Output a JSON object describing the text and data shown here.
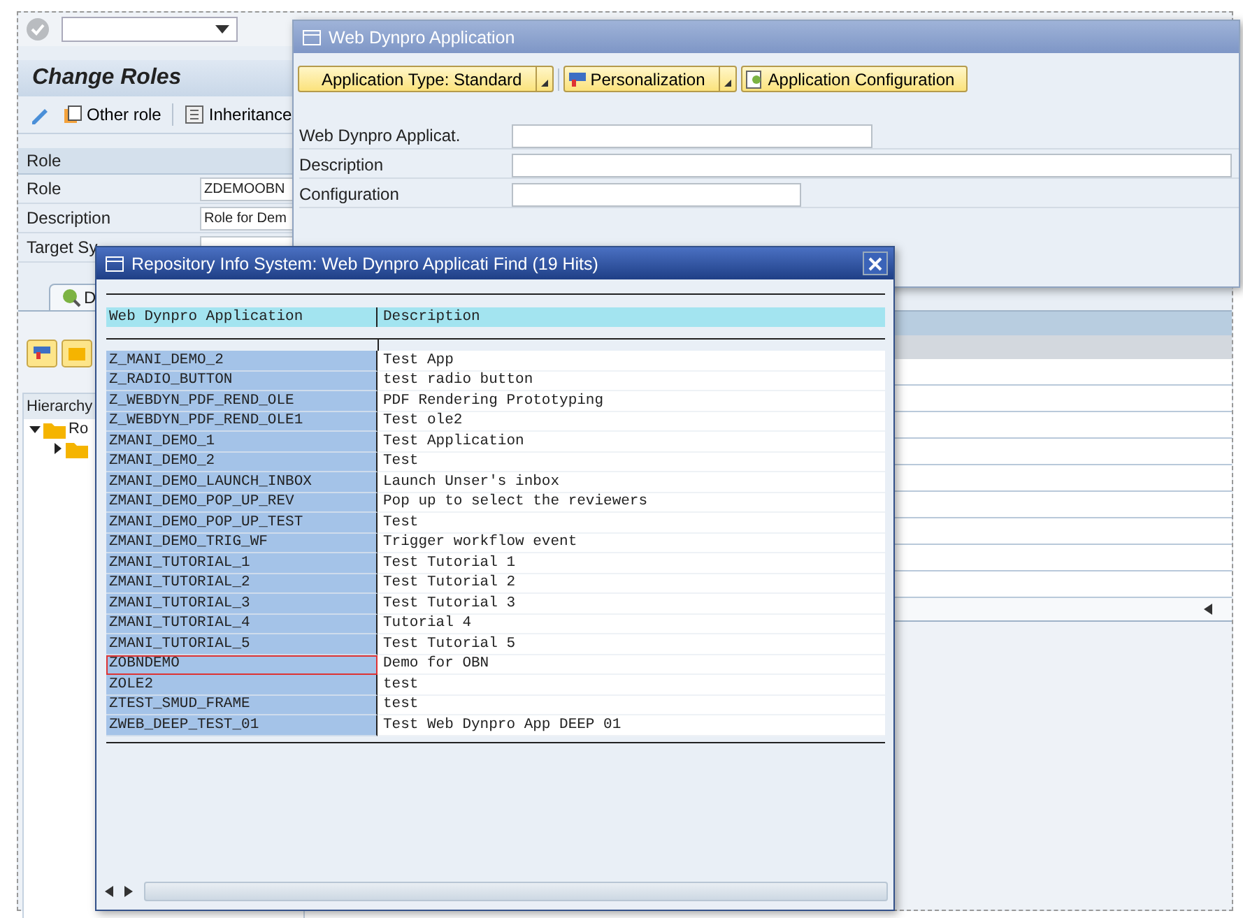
{
  "main_screen": {
    "title": "Change Roles",
    "toolbar_buttons": [
      {
        "label": "Other role"
      },
      {
        "label": "Inheritance"
      }
    ],
    "section_header": "Role",
    "fields": [
      {
        "label": "Role",
        "value": "ZDEMOOBN"
      },
      {
        "label": "Description",
        "value": "Role for Dem"
      },
      {
        "label": "Target Sy"
      }
    ],
    "tab": {
      "label": "D",
      "selected": true
    },
    "hierarchy": {
      "header": "Hierarchy",
      "tree": [
        {
          "label": "Ro",
          "expanded": true,
          "children": [
            {
              "expanded": false
            }
          ]
        }
      ]
    }
  },
  "app_dialog": {
    "title": "Web Dynpro Application",
    "buttons": [
      {
        "label": "Application Type: Standard",
        "kind": "menu"
      },
      {
        "label": "Personalization",
        "kind": "menu"
      },
      {
        "label": "Application Configuration",
        "kind": "plain"
      }
    ],
    "fields": [
      {
        "label": "Web Dynpro Applicat."
      },
      {
        "label": "Description"
      },
      {
        "label": "Configuration"
      }
    ]
  },
  "popup": {
    "title": "Repository Info System: Web Dynpro Applicati Find (19 Hits)",
    "columns": [
      {
        "label": "Web Dynpro Application",
        "selected": true
      },
      {
        "label": "Description",
        "selected": false
      }
    ],
    "rows": [
      {
        "application": "Z_MANI_DEMO_2",
        "description": "Test App",
        "focused": false
      },
      {
        "application": "Z_RADIO_BUTTON",
        "description": "test radio button",
        "focused": false
      },
      {
        "application": "Z_WEBDYN_PDF_REND_OLE",
        "description": "PDF Rendering Prototyping",
        "focused": false
      },
      {
        "application": "Z_WEBDYN_PDF_REND_OLE1",
        "description": "Test ole2",
        "focused": false
      },
      {
        "application": "ZMANI_DEMO_1",
        "description": "Test Application",
        "focused": false
      },
      {
        "application": "ZMANI_DEMO_2",
        "description": "Test",
        "focused": false
      },
      {
        "application": "ZMANI_DEMO_LAUNCH_INBOX",
        "description": "Launch Unser's inbox",
        "focused": false
      },
      {
        "application": "ZMANI_DEMO_POP_UP_REV",
        "description": "Pop up to select the reviewers",
        "focused": false
      },
      {
        "application": "ZMANI_DEMO_POP_UP_TEST",
        "description": "Test",
        "focused": false
      },
      {
        "application": "ZMANI_DEMO_TRIG_WF",
        "description": "Trigger workflow event",
        "focused": false
      },
      {
        "application": "ZMANI_TUTORIAL_1",
        "description": "Test Tutorial 1",
        "focused": false
      },
      {
        "application": "ZMANI_TUTORIAL_2",
        "description": "Test Tutorial 2",
        "focused": false
      },
      {
        "application": "ZMANI_TUTORIAL_3",
        "description": "Test Tutorial 3",
        "focused": false
      },
      {
        "application": "ZMANI_TUTORIAL_4",
        "description": "Tutorial 4",
        "focused": false
      },
      {
        "application": "ZMANI_TUTORIAL_5",
        "description": "Test Tutorial 5",
        "focused": false
      },
      {
        "application": "ZOBNDEMO",
        "description": "Demo for OBN",
        "focused": true
      },
      {
        "application": "ZOLE2",
        "description": "test",
        "focused": false
      },
      {
        "application": "ZTEST_SMUD_FRAME",
        "description": "test",
        "focused": false
      },
      {
        "application": "ZWEB_DEEP_TEST_01",
        "description": "Test Web Dynpro App DEEP 01",
        "focused": false
      }
    ]
  }
}
